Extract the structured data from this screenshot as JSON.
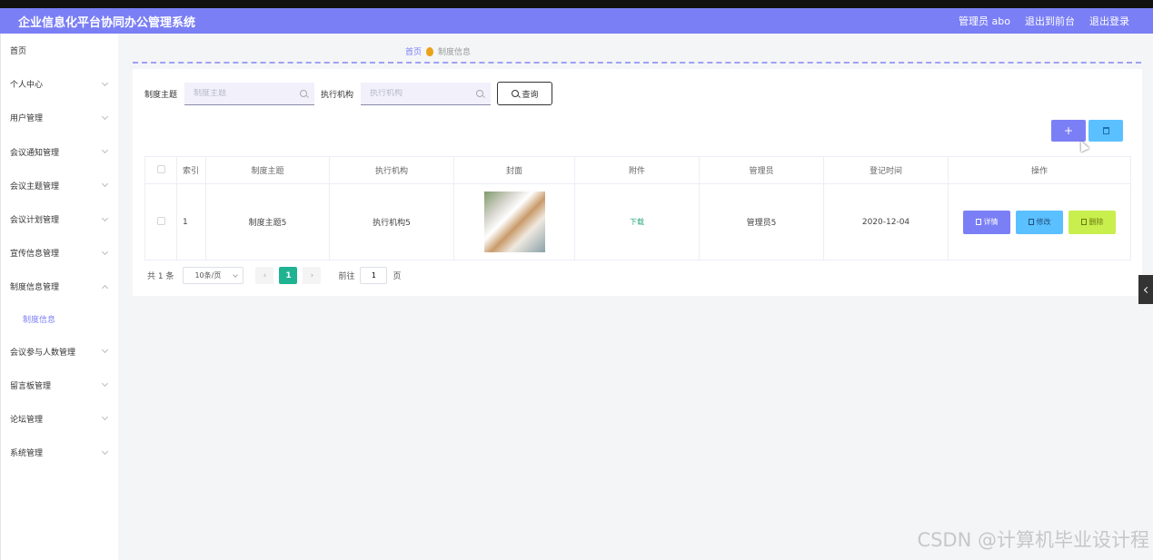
{
  "header": {
    "title": "企业信息化平台协同办公管理系统",
    "user": "管理员 abo",
    "back_to_front": "退出到前台",
    "logout": "退出登录"
  },
  "sidebar": {
    "items": [
      {
        "label": "首页",
        "chevron": false
      },
      {
        "label": "个人中心",
        "chevron": true
      },
      {
        "label": "用户管理",
        "chevron": true
      },
      {
        "label": "会议通知管理",
        "chevron": true
      },
      {
        "label": "会议主题管理",
        "chevron": true
      },
      {
        "label": "会议计划管理",
        "chevron": true
      },
      {
        "label": "宣传信息管理",
        "chevron": true
      },
      {
        "label": "制度信息管理",
        "chevron": true,
        "expanded": true
      },
      {
        "label": "会议参与人数管理",
        "chevron": true
      },
      {
        "label": "留言板管理",
        "chevron": true
      },
      {
        "label": "论坛管理",
        "chevron": true
      },
      {
        "label": "系统管理",
        "chevron": true
      }
    ],
    "subitem": "制度信息"
  },
  "breadcrumb": {
    "home": "首页",
    "current": "制度信息"
  },
  "search": {
    "label1": "制度主题",
    "placeholder1": "制度主题",
    "label2": "执行机构",
    "placeholder2": "执行机构",
    "button": "查询"
  },
  "actions": {
    "add_icon": "+",
    "delete_icon": "trash-icon"
  },
  "table": {
    "headers": [
      "索引",
      "制度主题",
      "执行机构",
      "封面",
      "附件",
      "管理员",
      "登记时间",
      "操作"
    ],
    "rows": [
      {
        "index": "1",
        "topic": "制度主题5",
        "org": "执行机构5",
        "attachment": "下载",
        "admin": "管理员5",
        "date": "2020-12-04",
        "detail": "详情",
        "edit": "修改",
        "delete": "删除"
      }
    ]
  },
  "pagination": {
    "total": "共 1 条",
    "page_size": "10条/页",
    "current_page": "1",
    "goto_label": "前往",
    "goto_value": "1",
    "page_suffix": "页"
  },
  "watermark": "CSDN @计算机毕业设计程",
  "colors": {
    "header": "#7b7ff5",
    "accent": "#7b7ff5",
    "pager_active": "#1fb392"
  }
}
